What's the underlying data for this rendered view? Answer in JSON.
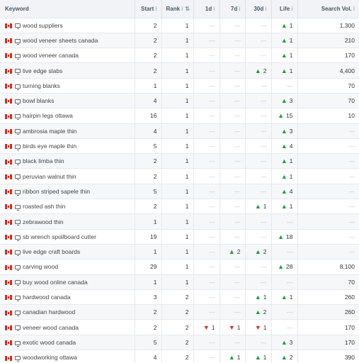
{
  "headers": {
    "keyword": "Keyword",
    "start": "Start",
    "rank": "Rank",
    "d1": "1d",
    "d7": "7d",
    "d30": "30d",
    "life": "Life",
    "volume": "Search Vol."
  },
  "rows": [
    {
      "keyword": "wood suppliers",
      "start": "2",
      "rank": "1",
      "d1": "",
      "d7": "",
      "d30": "",
      "life": {
        "dir": "up",
        "val": "1"
      },
      "vol": "1,300"
    },
    {
      "keyword": "wood veneer sheets canada",
      "start": "2",
      "rank": "1",
      "d1": "",
      "d7": "",
      "d30": "",
      "life": {
        "dir": "up",
        "val": "1"
      },
      "vol": "210"
    },
    {
      "keyword": "wood veneer canada",
      "start": "2",
      "rank": "1",
      "d1": "",
      "d7": "",
      "d30": "",
      "life": {
        "dir": "up",
        "val": "1"
      },
      "vol": "170"
    },
    {
      "keyword": "live edge slabs",
      "start": "2",
      "rank": "1",
      "d1": "",
      "d7": "",
      "d30": {
        "dir": "up",
        "val": "2"
      },
      "life": {
        "dir": "up",
        "val": "1"
      },
      "vol": "4,400"
    },
    {
      "keyword": "turning blanks",
      "start": "1",
      "rank": "1",
      "d1": "",
      "d7": "",
      "d30": "",
      "life": "",
      "vol": "70"
    },
    {
      "keyword": "bowl blanks",
      "start": "4",
      "rank": "1",
      "d1": "",
      "d7": "",
      "d30": "",
      "life": {
        "dir": "up",
        "val": "3"
      },
      "vol": "70"
    },
    {
      "keyword": "hairpin legs ottawa",
      "start": "16",
      "rank": "1",
      "d1": "",
      "d7": "",
      "d30": "",
      "life": {
        "dir": "up",
        "val": "15"
      },
      "vol": "10"
    },
    {
      "keyword": "ambrosia maple thin",
      "start": "4",
      "rank": "1",
      "d1": "",
      "d7": "",
      "d30": "",
      "life": {
        "dir": "up",
        "val": "3"
      },
      "vol": ""
    },
    {
      "keyword": "birds eye maple thin",
      "start": "5",
      "rank": "1",
      "d1": "",
      "d7": "",
      "d30": "",
      "life": {
        "dir": "up",
        "val": "4"
      },
      "vol": ""
    },
    {
      "keyword": "black limba thin",
      "start": "2",
      "rank": "1",
      "d1": "",
      "d7": "",
      "d30": "",
      "life": {
        "dir": "up",
        "val": "1"
      },
      "vol": ""
    },
    {
      "keyword": "peruvian walnut thin",
      "start": "2",
      "rank": "1",
      "d1": "",
      "d7": "",
      "d30": "",
      "life": {
        "dir": "up",
        "val": "1"
      },
      "vol": ""
    },
    {
      "keyword": "ribbon striped sapele thin",
      "start": "5",
      "rank": "1",
      "d1": "",
      "d7": "",
      "d30": "",
      "life": {
        "dir": "up",
        "val": "4"
      },
      "vol": ""
    },
    {
      "keyword": "roasted ash thin",
      "start": "2",
      "rank": "1",
      "d1": "",
      "d7": "",
      "d30": {
        "dir": "up",
        "val": "1"
      },
      "life": {
        "dir": "up",
        "val": "1"
      },
      "vol": ""
    },
    {
      "keyword": "zebrawood thin",
      "start": "1",
      "rank": "1",
      "d1": "",
      "d7": "",
      "d30": "",
      "life": "",
      "vol": ""
    },
    {
      "keyword": "sb wrench spoilboard cutter",
      "start": "19",
      "rank": "1",
      "d1": "",
      "d7": "",
      "d30": "",
      "life": {
        "dir": "up",
        "val": "18"
      },
      "vol": ""
    },
    {
      "keyword": "live edge craft boards",
      "start": "1",
      "rank": "1",
      "d1": "",
      "d7": {
        "dir": "up",
        "val": "2"
      },
      "d30": {
        "dir": "up",
        "val": "2"
      },
      "life": "",
      "vol": ""
    },
    {
      "keyword": "carving wood",
      "start": "29",
      "rank": "1",
      "d1": "",
      "d7": "",
      "d30": "",
      "life": {
        "dir": "up",
        "val": "28"
      },
      "vol": "8,100"
    },
    {
      "keyword": "buy wood online canada",
      "start": "1",
      "rank": "1",
      "d1": "",
      "d7": "",
      "d30": "",
      "life": "",
      "vol": "70"
    },
    {
      "keyword": "hardwood canada",
      "start": "3",
      "rank": "2",
      "d1": "",
      "d7": "",
      "d30": {
        "dir": "up",
        "val": "1"
      },
      "life": {
        "dir": "up",
        "val": "1"
      },
      "vol": "260"
    },
    {
      "keyword": "canadian hardwood",
      "start": "2",
      "rank": "2",
      "d1": "",
      "d7": "",
      "d30": {
        "dir": "up",
        "val": "2"
      },
      "life": "",
      "vol": "260"
    },
    {
      "keyword": "veneer wood canada",
      "start": "2",
      "rank": "2",
      "d1": {
        "dir": "down",
        "val": "1"
      },
      "d7": {
        "dir": "down",
        "val": "1"
      },
      "d30": {
        "dir": "down",
        "val": "1"
      },
      "life": "",
      "vol": "170"
    },
    {
      "keyword": "exotic wood canada",
      "start": "5",
      "rank": "2",
      "d1": "",
      "d7": "",
      "d30": "",
      "life": {
        "dir": "up",
        "val": "3"
      },
      "vol": "170"
    },
    {
      "keyword": "woodworking ottawa",
      "start": "4",
      "rank": "2",
      "d1": "",
      "d7": {
        "dir": "up",
        "val": "1"
      },
      "d30": {
        "dir": "up",
        "val": "1"
      },
      "life": {
        "dir": "up",
        "val": "2"
      },
      "vol": "390"
    }
  ],
  "icons": {
    "country_flag": "canada-flag-icon",
    "device": "desktop-monitor-icon",
    "info": "info-icon",
    "sort": "sort-icon",
    "up": "arrow-up-icon",
    "down": "arrow-down-icon"
  },
  "colors": {
    "up": "#1f9d3a",
    "down": "#d0302b",
    "header_bg": "#f1f3f6"
  }
}
